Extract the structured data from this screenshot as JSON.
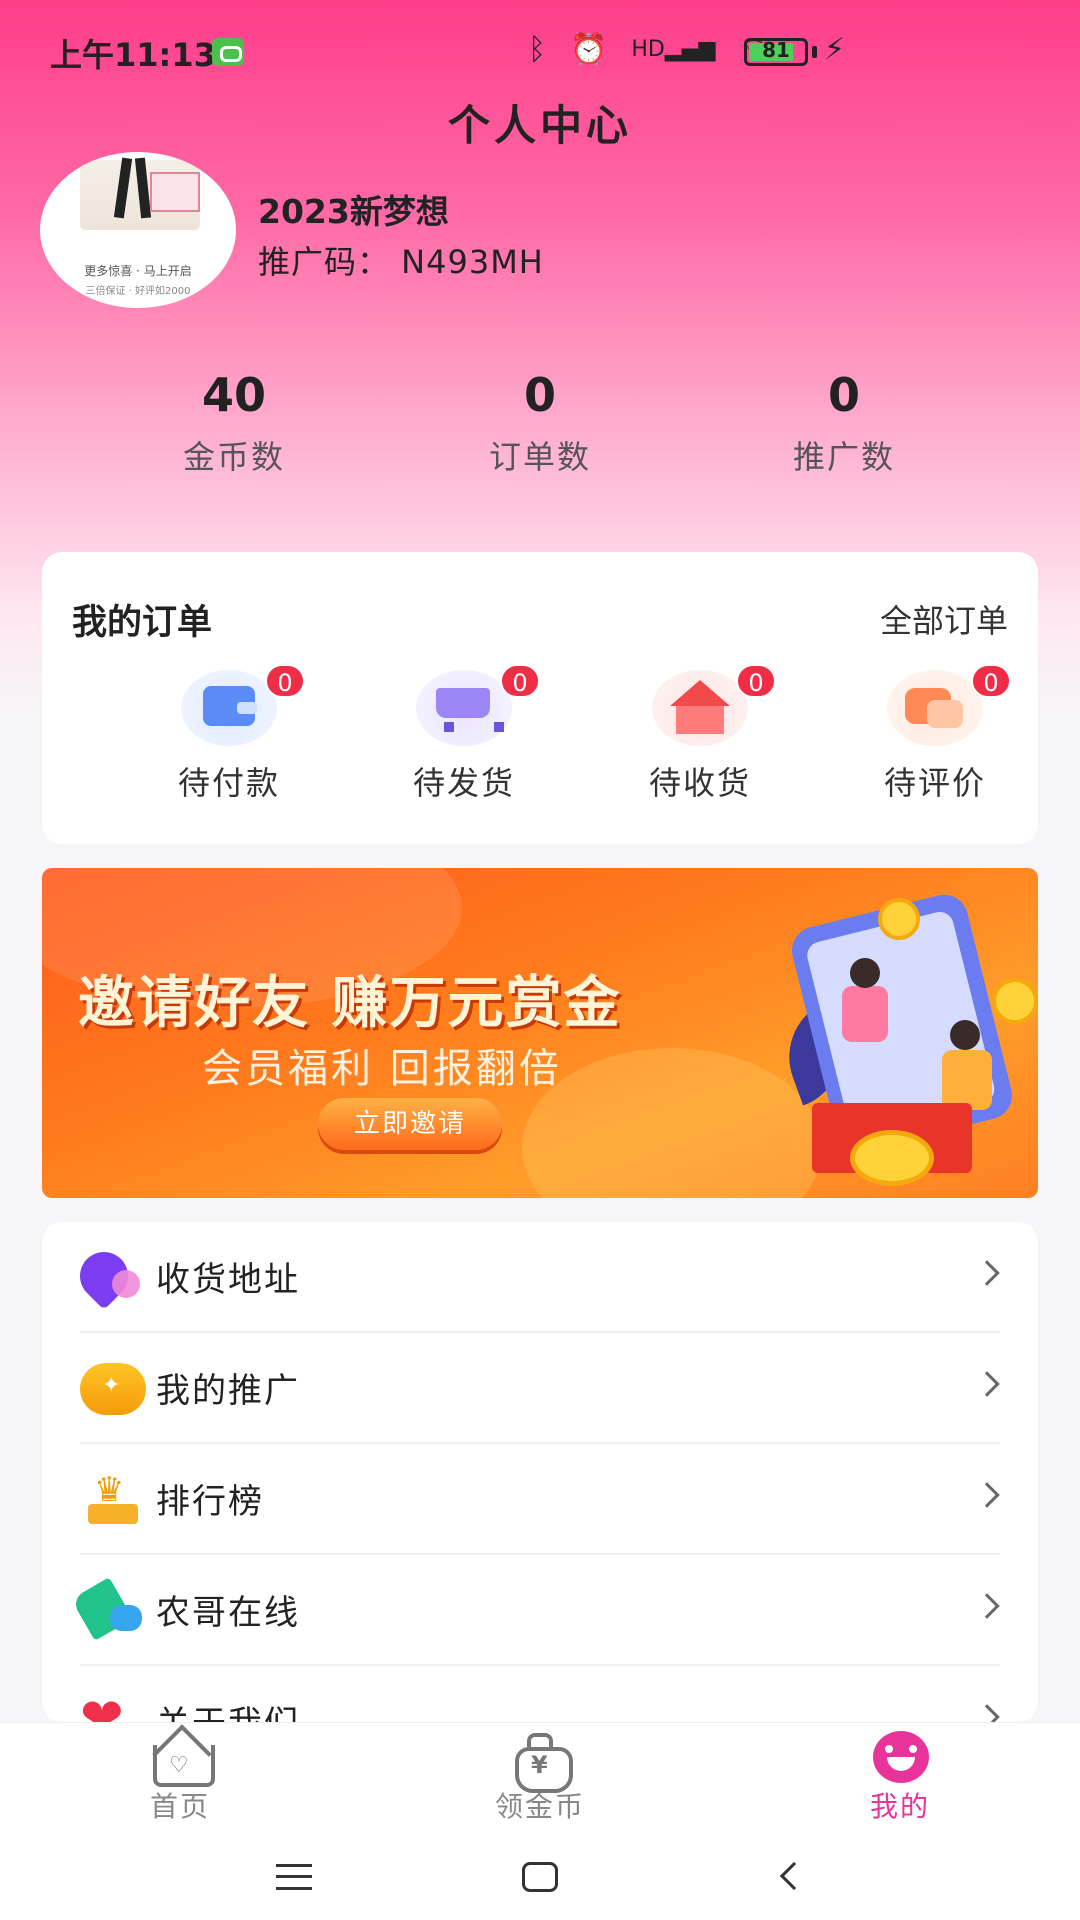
{
  "status_bar": {
    "time": "上午11:13",
    "battery": "81",
    "icons": [
      "bluetooth-icon",
      "alarm-icon",
      "hd-signal-icon",
      "wifi-icon",
      "battery-icon",
      "charging-icon"
    ]
  },
  "header": {
    "title": "个人中心"
  },
  "profile": {
    "avatar_text_1": "更多惊喜 · 马上开启",
    "avatar_text_2": "三倍保证 · 好评如2000",
    "username": "2023新梦想",
    "promo_code": "推广码： N493MH"
  },
  "stats": [
    {
      "value": "40",
      "label": "金币数"
    },
    {
      "value": "0",
      "label": "订单数"
    },
    {
      "value": "0",
      "label": "推广数"
    }
  ],
  "orders": {
    "title": "我的订单",
    "all_label": "全部订单",
    "items": [
      {
        "label": "待付款",
        "badge": "0",
        "icon": "wallet-icon"
      },
      {
        "label": "待发货",
        "badge": "0",
        "icon": "cart-icon"
      },
      {
        "label": "待收货",
        "badge": "0",
        "icon": "house-icon"
      },
      {
        "label": "待评价",
        "badge": "0",
        "icon": "chat-icon"
      }
    ]
  },
  "banner": {
    "title": "邀请好友  赚万元赏金",
    "subtitle": "会员福利 回报翻倍",
    "button": "立即邀请"
  },
  "menu": {
    "items": [
      {
        "label": "收货地址",
        "icon": "location-pin-icon"
      },
      {
        "label": "我的推广",
        "icon": "coin-icon"
      },
      {
        "label": "排行榜",
        "icon": "trophy-icon"
      },
      {
        "label": "农哥在线",
        "icon": "phone-icon"
      },
      {
        "label": "关于我们",
        "icon": "heart-icon"
      }
    ]
  },
  "tabbar": {
    "items": [
      {
        "label": "首页",
        "icon": "home-icon"
      },
      {
        "label": "领金币",
        "icon": "money-bag-icon"
      },
      {
        "label": "我的",
        "icon": "smile-icon"
      }
    ],
    "active_color": "#e8349a"
  },
  "colors": {
    "accent": "#ff3d8a",
    "badge": "#f02d47",
    "banner": "#ff7a1c"
  }
}
